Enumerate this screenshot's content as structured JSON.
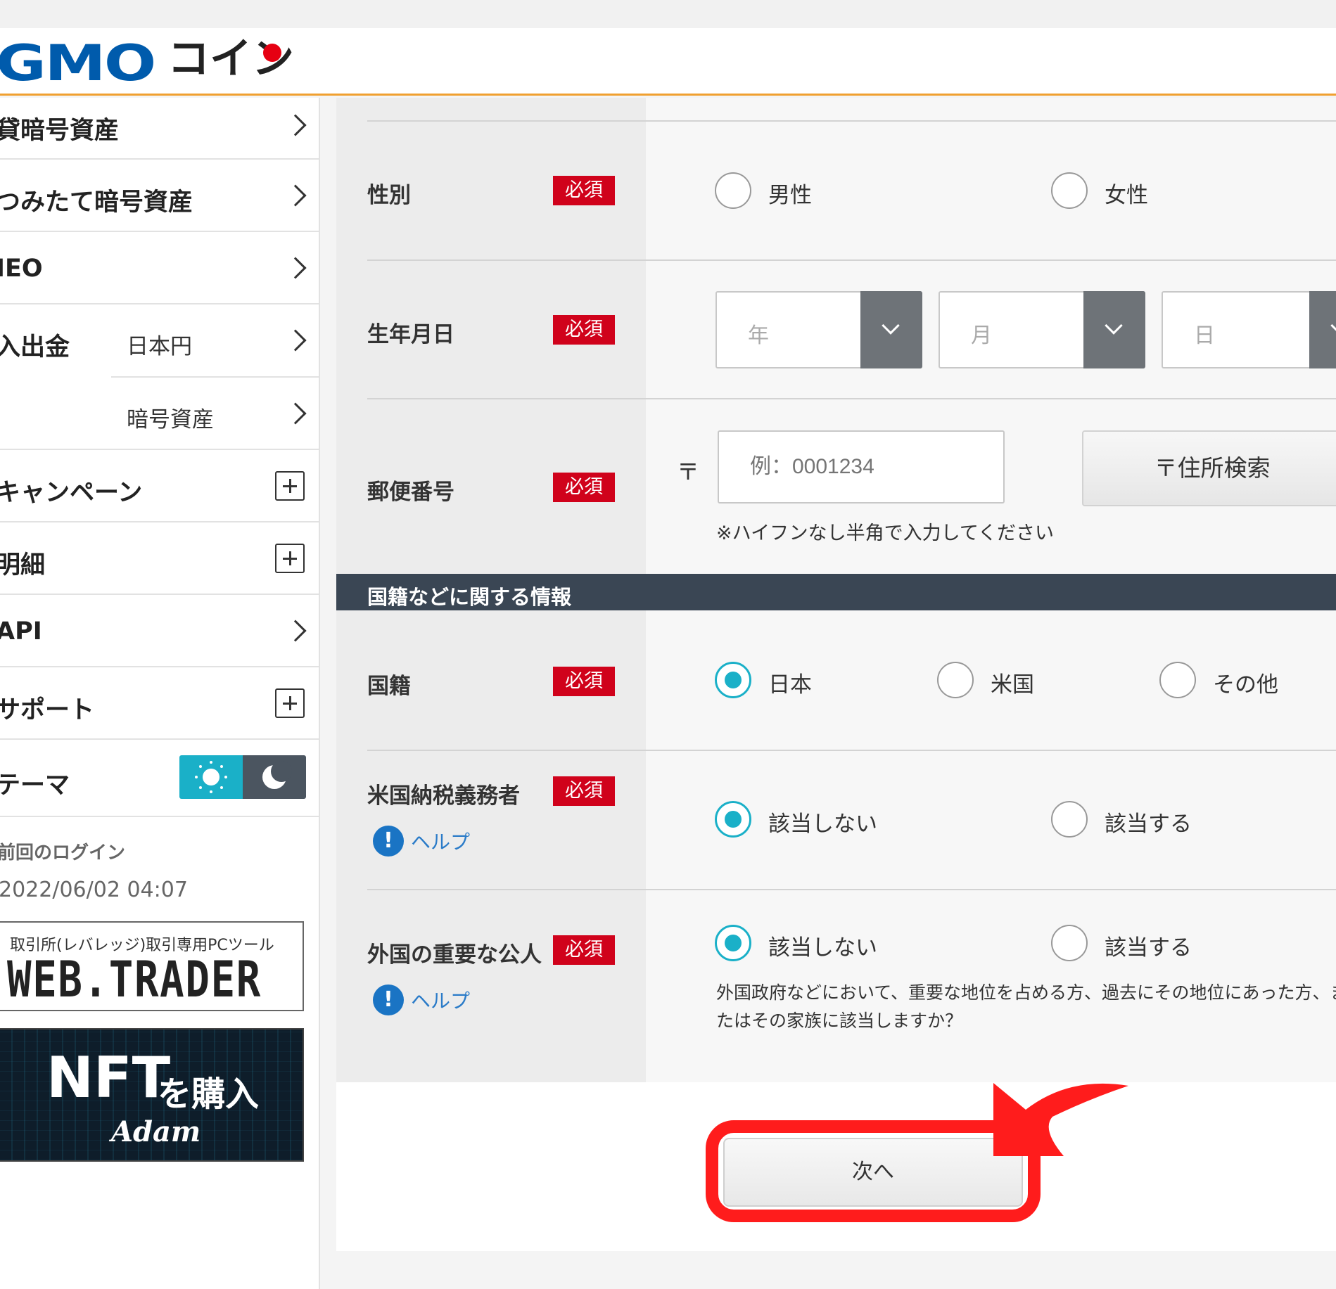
{
  "header": {
    "logo_text": "GMO",
    "logo_text_ja": "コイン"
  },
  "sidebar": {
    "items": [
      {
        "label": "貸暗号資産",
        "control": "chevron"
      },
      {
        "label": "つみたて暗号資産",
        "control": "chevron"
      },
      {
        "label": "IEO",
        "control": "chevron"
      },
      {
        "label": "入出金",
        "sub_label": "日本円",
        "control": "chevron"
      },
      {
        "sub_label": "暗号資産",
        "control": "chevron"
      },
      {
        "label": "キャンペーン",
        "control": "plus"
      },
      {
        "label": "明細",
        "control": "plus"
      },
      {
        "label": "API",
        "control": "chevron"
      },
      {
        "label": "サポート",
        "control": "plus"
      },
      {
        "label": "テーマ",
        "control": "theme-toggle"
      }
    ],
    "last_login_title": "前回のログイン",
    "last_login_date": "2022/06/02 04:07",
    "banner_web": {
      "subtitle": "取引所(レバレッジ)取引専用PCツール",
      "title": "WEB.TRADER"
    },
    "banner_nft": {
      "title": "NFT",
      "title_ja": "を購入",
      "brand": "Adam"
    }
  },
  "form": {
    "required_label": "必須",
    "gender": {
      "label": "性別",
      "options": [
        "男性",
        "女性"
      ],
      "selected": null
    },
    "birthdate": {
      "label": "生年月日",
      "year_placeholder": "年",
      "month_placeholder": "月",
      "day_placeholder": "日"
    },
    "postal": {
      "label": "郵便番号",
      "mark": "〒",
      "placeholder": "例：0001234",
      "search_button": "〒住所検索",
      "note": "※ハイフンなし半角で入力してください"
    },
    "section_title": "国籍などに関する情報",
    "nationality": {
      "label": "国籍",
      "options": [
        "日本",
        "米国",
        "その他"
      ],
      "selected": "日本"
    },
    "us_taxpayer": {
      "label": "米国納税義務者",
      "help": "ヘルプ",
      "options": [
        "該当しない",
        "該当する"
      ],
      "selected": "該当しない"
    },
    "foreign_pep": {
      "label": "外国の重要な公人",
      "help": "ヘルプ",
      "options": [
        "該当しない",
        "該当する"
      ],
      "selected": "該当しない",
      "description": "外国政府などにおいて、重要な地位を占める方、過去にその地位にあった方、またはその家族に該当しますか？"
    },
    "next_button": "次へ"
  },
  "colors": {
    "brand_blue": "#005bac",
    "brand_red": "#e60012",
    "header_accent": "#f0a030",
    "required_badge": "#d0021b",
    "radio_selected": "#1ab0c8",
    "section_bar": "#3a4654",
    "annotation_red": "#ff1c1c"
  },
  "icons": [
    "chevron-right-icon",
    "plus-icon",
    "sun-icon",
    "moon-icon",
    "chevron-down-icon",
    "help-icon",
    "annotation-arrow-icon"
  ]
}
